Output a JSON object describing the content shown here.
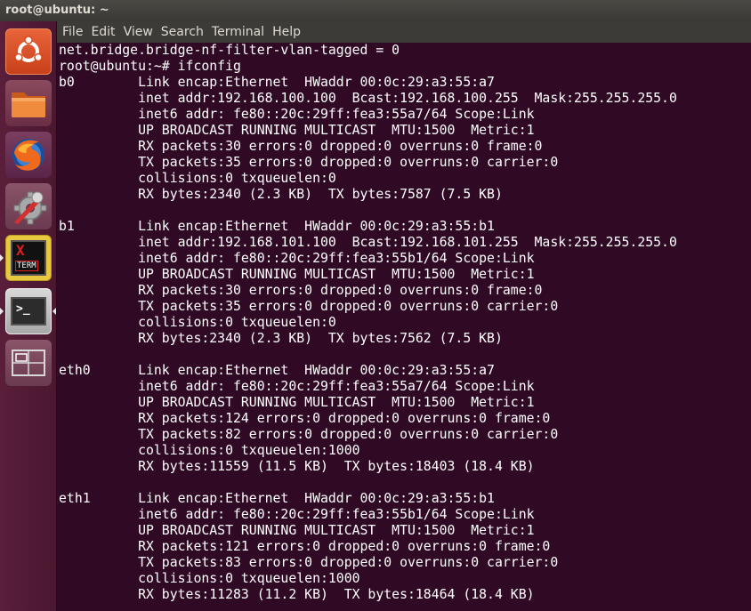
{
  "window": {
    "title": "root@ubuntu: ~"
  },
  "menu": [
    "File",
    "Edit",
    "View",
    "Search",
    "Terminal",
    "Help"
  ],
  "launcher": {
    "items": [
      {
        "name": "ubuntu-dash",
        "icon": "ubuntu-logo-icon",
        "color": "#dd4814"
      },
      {
        "name": "files",
        "icon": "folder-icon",
        "color": "#e8792f"
      },
      {
        "name": "firefox",
        "icon": "firefox-icon",
        "color": "#e66000"
      },
      {
        "name": "system-settings",
        "icon": "settings-wrench-icon",
        "color": "#c0c0c0"
      },
      {
        "name": "xterm",
        "icon": "xterm-icon",
        "label_x": "X",
        "label_term": "TERM",
        "color": "#e8c840"
      },
      {
        "name": "terminal",
        "icon": "terminal-icon",
        "prompt": ">_",
        "color": "#2c2c2c"
      },
      {
        "name": "workspace-switcher",
        "icon": "workspace-switcher-icon",
        "color": "#c0c0c0"
      }
    ]
  },
  "terminal": {
    "lines": [
      "net.bridge.bridge-nf-filter-vlan-tagged = 0",
      "root@ubuntu:~# ifconfig",
      "b0        Link encap:Ethernet  HWaddr 00:0c:29:a3:55:a7",
      "          inet addr:192.168.100.100  Bcast:192.168.100.255  Mask:255.255.255.0",
      "          inet6 addr: fe80::20c:29ff:fea3:55a7/64 Scope:Link",
      "          UP BROADCAST RUNNING MULTICAST  MTU:1500  Metric:1",
      "          RX packets:30 errors:0 dropped:0 overruns:0 frame:0",
      "          TX packets:35 errors:0 dropped:0 overruns:0 carrier:0",
      "          collisions:0 txqueuelen:0",
      "          RX bytes:2340 (2.3 KB)  TX bytes:7587 (7.5 KB)",
      "",
      "b1        Link encap:Ethernet  HWaddr 00:0c:29:a3:55:b1",
      "          inet addr:192.168.101.100  Bcast:192.168.101.255  Mask:255.255.255.0",
      "          inet6 addr: fe80::20c:29ff:fea3:55b1/64 Scope:Link",
      "          UP BROADCAST RUNNING MULTICAST  MTU:1500  Metric:1",
      "          RX packets:30 errors:0 dropped:0 overruns:0 frame:0",
      "          TX packets:35 errors:0 dropped:0 overruns:0 carrier:0",
      "          collisions:0 txqueuelen:0",
      "          RX bytes:2340 (2.3 KB)  TX bytes:7562 (7.5 KB)",
      "",
      "eth0      Link encap:Ethernet  HWaddr 00:0c:29:a3:55:a7",
      "          inet6 addr: fe80::20c:29ff:fea3:55a7/64 Scope:Link",
      "          UP BROADCAST RUNNING MULTICAST  MTU:1500  Metric:1",
      "          RX packets:124 errors:0 dropped:0 overruns:0 frame:0",
      "          TX packets:82 errors:0 dropped:0 overruns:0 carrier:0",
      "          collisions:0 txqueuelen:1000",
      "          RX bytes:11559 (11.5 KB)  TX bytes:18403 (18.4 KB)",
      "",
      "eth1      Link encap:Ethernet  HWaddr 00:0c:29:a3:55:b1",
      "          inet6 addr: fe80::20c:29ff:fea3:55b1/64 Scope:Link",
      "          UP BROADCAST RUNNING MULTICAST  MTU:1500  Metric:1",
      "          RX packets:121 errors:0 dropped:0 overruns:0 frame:0",
      "          TX packets:83 errors:0 dropped:0 overruns:0 carrier:0",
      "          collisions:0 txqueuelen:1000",
      "          RX bytes:11283 (11.2 KB)  TX bytes:18464 (18.4 KB)"
    ]
  }
}
